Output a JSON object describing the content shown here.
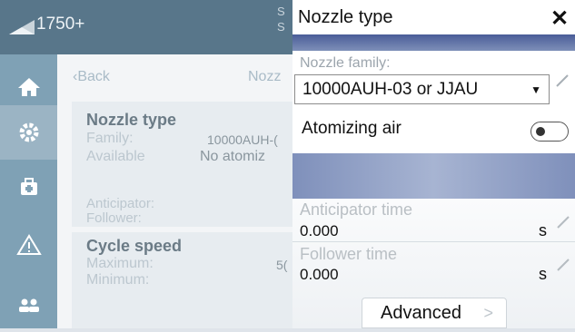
{
  "header": {
    "model": "1750+",
    "status_char": "S S"
  },
  "nav": [
    {
      "id": "home",
      "icon": "home-icon"
    },
    {
      "id": "settings",
      "icon": "gear-icon"
    },
    {
      "id": "service",
      "icon": "toolbox-icon"
    },
    {
      "id": "alerts",
      "icon": "warning-icon"
    },
    {
      "id": "users",
      "icon": "users-icon"
    }
  ],
  "page": {
    "back_label": "Back",
    "title": "Nozz",
    "nozzle_card": {
      "title": "Nozzle type",
      "family_label": "Family:",
      "family_value": "10000AUH-(",
      "available_label": "Available",
      "available_value": "No atomiz",
      "anticipator_label": "Anticipator:",
      "follower_label": "Follower:"
    },
    "cycle_card": {
      "title": "Cycle speed",
      "max_label": "Maximum:",
      "max_value": "5(",
      "min_label": "Minimum:"
    }
  },
  "dialog": {
    "title": "Nozzle type",
    "close_symbol": "✕",
    "family_label": "Nozzle family:",
    "family_value": "10000AUH-03 or JJAU",
    "atomizing_label": "Atomizing air",
    "atomizing_on": false,
    "anticipator_label": "Anticipator time",
    "anticipator_value": "0.000",
    "anticipator_unit": "s",
    "follower_label": "Follower time",
    "follower_value": "0.000",
    "follower_unit": "s",
    "advanced_label": "Advanced",
    "advanced_chevron": ">"
  }
}
